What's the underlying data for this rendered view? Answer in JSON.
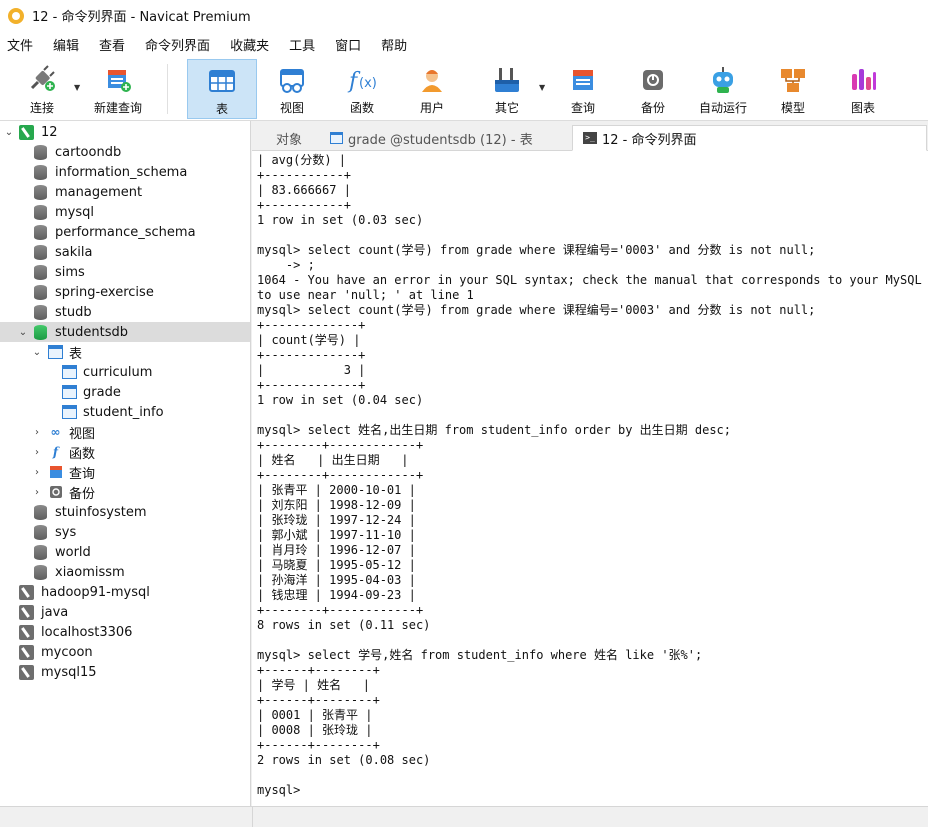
{
  "window": {
    "title": "12 - 命令列界面 - Navicat Premium"
  },
  "menu": [
    "文件",
    "编辑",
    "查看",
    "命令列界面",
    "收藏夹",
    "工具",
    "窗口",
    "帮助"
  ],
  "toolbar": [
    {
      "label": "连接",
      "icon": "plug-icon"
    },
    {
      "label": "新建查询",
      "icon": "new-query-icon"
    },
    {
      "label": "表",
      "icon": "table-icon"
    },
    {
      "label": "视图",
      "icon": "view-icon"
    },
    {
      "label": "函数",
      "icon": "function-icon"
    },
    {
      "label": "用户",
      "icon": "user-icon"
    },
    {
      "label": "其它",
      "icon": "tools-icon"
    },
    {
      "label": "查询",
      "icon": "query-icon"
    },
    {
      "label": "备份",
      "icon": "backup-icon"
    },
    {
      "label": "自动运行",
      "icon": "robot-icon"
    },
    {
      "label": "模型",
      "icon": "model-icon"
    },
    {
      "label": "图表",
      "icon": "chart-icon"
    }
  ],
  "sidebar": {
    "connection": "12",
    "databases": [
      "cartoondb",
      "information_schema",
      "management",
      "mysql",
      "performance_schema",
      "sakila",
      "sims",
      "spring-exercise",
      "studb"
    ],
    "active_db": "studentsdb",
    "tables_group": "表",
    "tables": [
      "curriculum",
      "grade",
      "student_info"
    ],
    "groups": [
      {
        "label": "视图",
        "icon": "view-icon"
      },
      {
        "label": "函数",
        "icon": "function-icon"
      },
      {
        "label": "查询",
        "icon": "query-icon"
      },
      {
        "label": "备份",
        "icon": "backup-icon"
      }
    ],
    "more_databases": [
      "stuinfosystem",
      "sys",
      "world",
      "xiaomissm"
    ],
    "connections": [
      "hadoop91-mysql",
      "java",
      "localhost3306",
      "mycoon",
      "mysql15"
    ]
  },
  "tabs": [
    {
      "label": "对象"
    },
    {
      "label": "grade @studentsdb (12) - 表"
    },
    {
      "label": "12 - 命令列界面"
    }
  ],
  "console": {
    "text": "| avg(分数) |\n+-----------+\n| 83.666667 |\n+-----------+\n1 row in set (0.03 sec)\n\nmysql> select count(学号) from grade where 课程编号='0003' and 分数 is not null;\n    -> ;\n1064 - You have an error in your SQL syntax; check the manual that corresponds to your MySQL ser\nto use near 'null; ' at line 1\nmysql> select count(学号) from grade where 课程编号='0003' and 分数 is not null;\n+-------------+\n| count(学号) |\n+-------------+\n|           3 |\n+-------------+\n1 row in set (0.04 sec)\n\nmysql> select 姓名,出生日期 from student_info order by 出生日期 desc;\n+--------+------------+\n| 姓名   | 出生日期   |\n+--------+------------+\n| 张青平 | 2000-10-01 |\n| 刘东阳 | 1998-12-09 |\n| 张玲珑 | 1997-12-24 |\n| 郭小斌 | 1997-11-10 |\n| 肖月玲 | 1996-12-07 |\n| 马晓夏 | 1995-05-12 |\n| 孙海洋 | 1995-04-03 |\n| 钱忠理 | 1994-09-23 |\n+--------+------------+\n8 rows in set (0.11 sec)\n\nmysql> select 学号,姓名 from student_info where 姓名 like '张%';\n+------+--------+\n| 学号 | 姓名   |\n+------+--------+\n| 0001 | 张青平 |\n| 0008 | 张玲珑 |\n+------+--------+\n2 rows in set (0.08 sec)\n\nmysql>"
  }
}
